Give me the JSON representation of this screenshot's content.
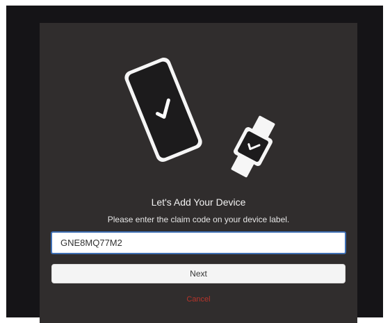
{
  "dialog": {
    "title": "Let's Add Your Device",
    "subtitle": "Please enter the claim code on your device label.",
    "claim_code_value": "GNE8MQ77M2",
    "next_label": "Next",
    "cancel_label": "Cancel"
  },
  "illustration": {
    "phone_icon": "smartphone-check-icon",
    "watch_icon": "smartwatch-check-icon"
  },
  "colors": {
    "frame_background": "#151417",
    "dialog_background": "#302d2d",
    "input_focus_border": "#3f6fb3",
    "cancel_text": "#b5342b"
  }
}
